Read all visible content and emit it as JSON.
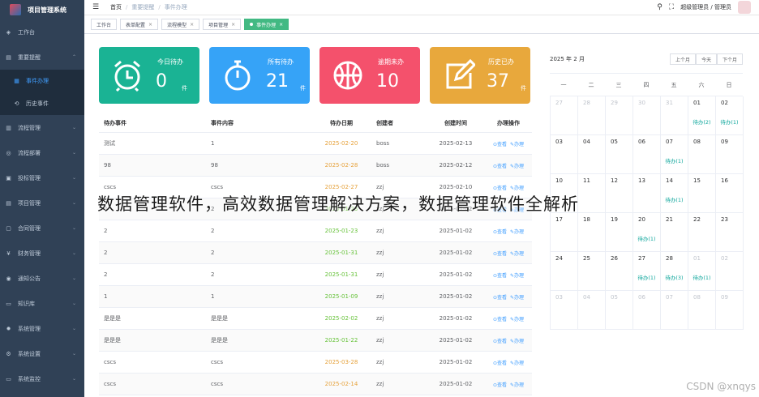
{
  "app": {
    "title": "项目管理系统"
  },
  "sidebar": {
    "items": [
      {
        "label": "工作台",
        "icon": "dashboard-icon",
        "has_arrow": false
      },
      {
        "label": "重要提醒",
        "icon": "alert-icon",
        "has_arrow": true,
        "expanded": true,
        "children": [
          {
            "label": "事件办理",
            "icon": "list-icon",
            "active": true
          },
          {
            "label": "历史事件",
            "icon": "history-icon",
            "active": false
          }
        ]
      },
      {
        "label": "流程管理",
        "icon": "flow-icon",
        "has_arrow": true
      },
      {
        "label": "流程部署",
        "icon": "deploy-icon",
        "has_arrow": true
      },
      {
        "label": "投标管理",
        "icon": "bid-icon",
        "has_arrow": true
      },
      {
        "label": "项目管理",
        "icon": "project-icon",
        "has_arrow": true
      },
      {
        "label": "合同管理",
        "icon": "contract-icon",
        "has_arrow": true
      },
      {
        "label": "财务管理",
        "icon": "yen-icon",
        "has_arrow": true
      },
      {
        "label": "通知公告",
        "icon": "notice-icon",
        "has_arrow": true
      },
      {
        "label": "知识库",
        "icon": "book-icon",
        "has_arrow": true
      },
      {
        "label": "系统管理",
        "icon": "gear-icon",
        "has_arrow": true
      },
      {
        "label": "系统设置",
        "icon": "settings-icon",
        "has_arrow": true
      },
      {
        "label": "系统监控",
        "icon": "monitor-icon",
        "has_arrow": true
      }
    ]
  },
  "header": {
    "breadcrumb": [
      "首页",
      "重要提醒",
      "事件办理"
    ],
    "user_label": "超级管理员 / 管理员"
  },
  "tags": [
    {
      "label": "工作台",
      "closable": false,
      "active": false
    },
    {
      "label": "表单配置",
      "closable": true,
      "active": false
    },
    {
      "label": "流程模型",
      "closable": true,
      "active": false
    },
    {
      "label": "项目管理",
      "closable": true,
      "active": false
    },
    {
      "label": "事件办理",
      "closable": true,
      "active": true
    }
  ],
  "cards": [
    {
      "title": "今日待办",
      "value": "0",
      "unit": "件",
      "color": "#1ab394",
      "icon": "alarm-clock-icon"
    },
    {
      "title": "所有待办",
      "value": "21",
      "unit": "件",
      "color": "#36a3f7",
      "icon": "stopwatch-icon"
    },
    {
      "title": "逾期未办",
      "value": "10",
      "unit": "",
      "color": "#f4516c",
      "icon": "basketball-icon"
    },
    {
      "title": "历史已办",
      "value": "37",
      "unit": "件",
      "color": "#e8a83c",
      "icon": "edit-icon"
    }
  ],
  "table": {
    "columns": [
      "待办事件",
      "事件内容",
      "待办日期",
      "创建者",
      "创建时间",
      "办理操作"
    ],
    "view_label": "查看",
    "handle_label": "办理",
    "rows": [
      {
        "event": "测试",
        "content": "1",
        "due": "2025-02-20",
        "due_color": "orange",
        "creator": "boss",
        "created": "2025-02-13"
      },
      {
        "event": "98",
        "content": "98",
        "due": "2025-02-28",
        "due_color": "orange",
        "creator": "boss",
        "created": "2025-02-12"
      },
      {
        "event": "cscs",
        "content": "cscs",
        "due": "2025-02-27",
        "due_color": "orange",
        "creator": "zzj",
        "created": "2025-02-10"
      },
      {
        "event": "2",
        "content": "2",
        "due": "2025-01-23",
        "due_color": "green",
        "creator": "zzj",
        "created": "2025-01-02"
      },
      {
        "event": "2",
        "content": "2",
        "due": "2025-01-23",
        "due_color": "green",
        "creator": "zzj",
        "created": "2025-01-02"
      },
      {
        "event": "2",
        "content": "2",
        "due": "2025-01-31",
        "due_color": "green",
        "creator": "zzj",
        "created": "2025-01-02"
      },
      {
        "event": "2",
        "content": "2",
        "due": "2025-01-31",
        "due_color": "green",
        "creator": "zzj",
        "created": "2025-01-02"
      },
      {
        "event": "1",
        "content": "1",
        "due": "2025-01-09",
        "due_color": "green",
        "creator": "zzj",
        "created": "2025-01-02"
      },
      {
        "event": "是是是",
        "content": "是是是",
        "due": "2025-02-02",
        "due_color": "green",
        "creator": "zzj",
        "created": "2025-01-02"
      },
      {
        "event": "是是是",
        "content": "是是是",
        "due": "2025-01-22",
        "due_color": "green",
        "creator": "zzj",
        "created": "2025-01-02"
      },
      {
        "event": "cscs",
        "content": "cscs",
        "due": "2025-03-28",
        "due_color": "orange",
        "creator": "zzj",
        "created": "2025-01-02"
      },
      {
        "event": "cscs",
        "content": "cscs",
        "due": "2025-02-14",
        "due_color": "orange",
        "creator": "zzj",
        "created": "2025-01-02"
      }
    ]
  },
  "calendar": {
    "title": "2025 年 2 月",
    "buttons": [
      "上个月",
      "今天",
      "下个月"
    ],
    "weekdays": [
      "一",
      "二",
      "三",
      "四",
      "五",
      "六",
      "日"
    ],
    "cells": [
      {
        "day": "27",
        "other": true
      },
      {
        "day": "28",
        "other": true
      },
      {
        "day": "29",
        "other": true
      },
      {
        "day": "30",
        "other": true
      },
      {
        "day": "31",
        "other": true
      },
      {
        "day": "01",
        "todo": "待办(2)"
      },
      {
        "day": "02",
        "todo": "待办(1)"
      },
      {
        "day": "03"
      },
      {
        "day": "04"
      },
      {
        "day": "05"
      },
      {
        "day": "06"
      },
      {
        "day": "07",
        "todo": "待办(1)"
      },
      {
        "day": "08"
      },
      {
        "day": "09"
      },
      {
        "day": "10"
      },
      {
        "day": "11"
      },
      {
        "day": "12"
      },
      {
        "day": "13"
      },
      {
        "day": "14",
        "todo": "待办(1)"
      },
      {
        "day": "15"
      },
      {
        "day": "16"
      },
      {
        "day": "17"
      },
      {
        "day": "18"
      },
      {
        "day": "19"
      },
      {
        "day": "20",
        "todo": "待办(1)"
      },
      {
        "day": "21"
      },
      {
        "day": "22"
      },
      {
        "day": "23"
      },
      {
        "day": "24"
      },
      {
        "day": "25"
      },
      {
        "day": "26"
      },
      {
        "day": "27",
        "todo": "待办(1)"
      },
      {
        "day": "28",
        "todo": "待办(3)"
      },
      {
        "day": "01",
        "other": true,
        "todo": "待办(1)"
      },
      {
        "day": "02",
        "other": true
      },
      {
        "day": "03",
        "other": true
      },
      {
        "day": "04",
        "other": true
      },
      {
        "day": "05",
        "other": true
      },
      {
        "day": "06",
        "other": true
      },
      {
        "day": "07",
        "other": true
      },
      {
        "day": "08",
        "other": true
      },
      {
        "day": "09",
        "other": true
      }
    ]
  },
  "overlay": {
    "caption": "数据管理软件，高效数据管理解决方案，数据管理软件全解析",
    "watermark": "CSDN @xnqys"
  }
}
